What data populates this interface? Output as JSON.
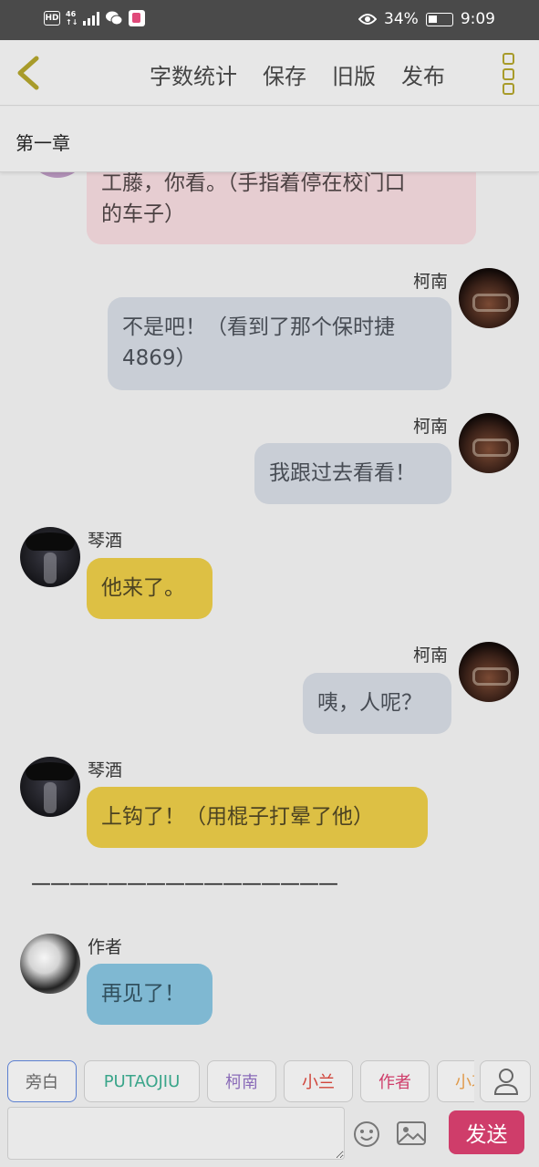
{
  "status_bar": {
    "hd": "HD",
    "network": "46",
    "network_sub": "↑↓",
    "battery_percent": "34%",
    "time": "9:09"
  },
  "toolbar": {
    "word_count": "字数统计",
    "save": "保存",
    "old_version": "旧版",
    "publish": "发布"
  },
  "chapter": {
    "title": "第一章"
  },
  "messages": [
    {
      "speaker": "",
      "side": "left",
      "text_lines": [
        "工藤，你看。（手指着停在校门口",
        "的车子）"
      ]
    },
    {
      "speaker": "柯南",
      "side": "right",
      "text_lines": [
        "不是吧！（看到了那个保时捷",
        "4869）"
      ]
    },
    {
      "speaker": "柯南",
      "side": "right",
      "text_lines": [
        "我跟过去看看！"
      ]
    },
    {
      "speaker": "琴酒",
      "side": "left",
      "text_lines": [
        "他来了。"
      ]
    },
    {
      "speaker": "柯南",
      "side": "right",
      "text_lines": [
        "咦，人呢？"
      ]
    },
    {
      "speaker": "琴酒",
      "side": "left",
      "text_lines": [
        "上钩了！（用棍子打晕了他）"
      ]
    },
    {
      "speaker": "作者",
      "side": "left",
      "text_lines": [
        "再见了！"
      ]
    }
  ],
  "divider": "————————————————",
  "roles": [
    "旁白",
    "PUTAOJIU",
    "柯南",
    "小兰",
    "作者",
    "小哀"
  ],
  "colors": {
    "putaojiu": "#3aa58a",
    "conan": "#8a6bb8",
    "ran": "#d0443a",
    "author": "#cf3d6a",
    "ai": "#e09a4a",
    "send": "#cf3d6a"
  },
  "input": {
    "placeholder": ""
  },
  "send_label": "发送"
}
